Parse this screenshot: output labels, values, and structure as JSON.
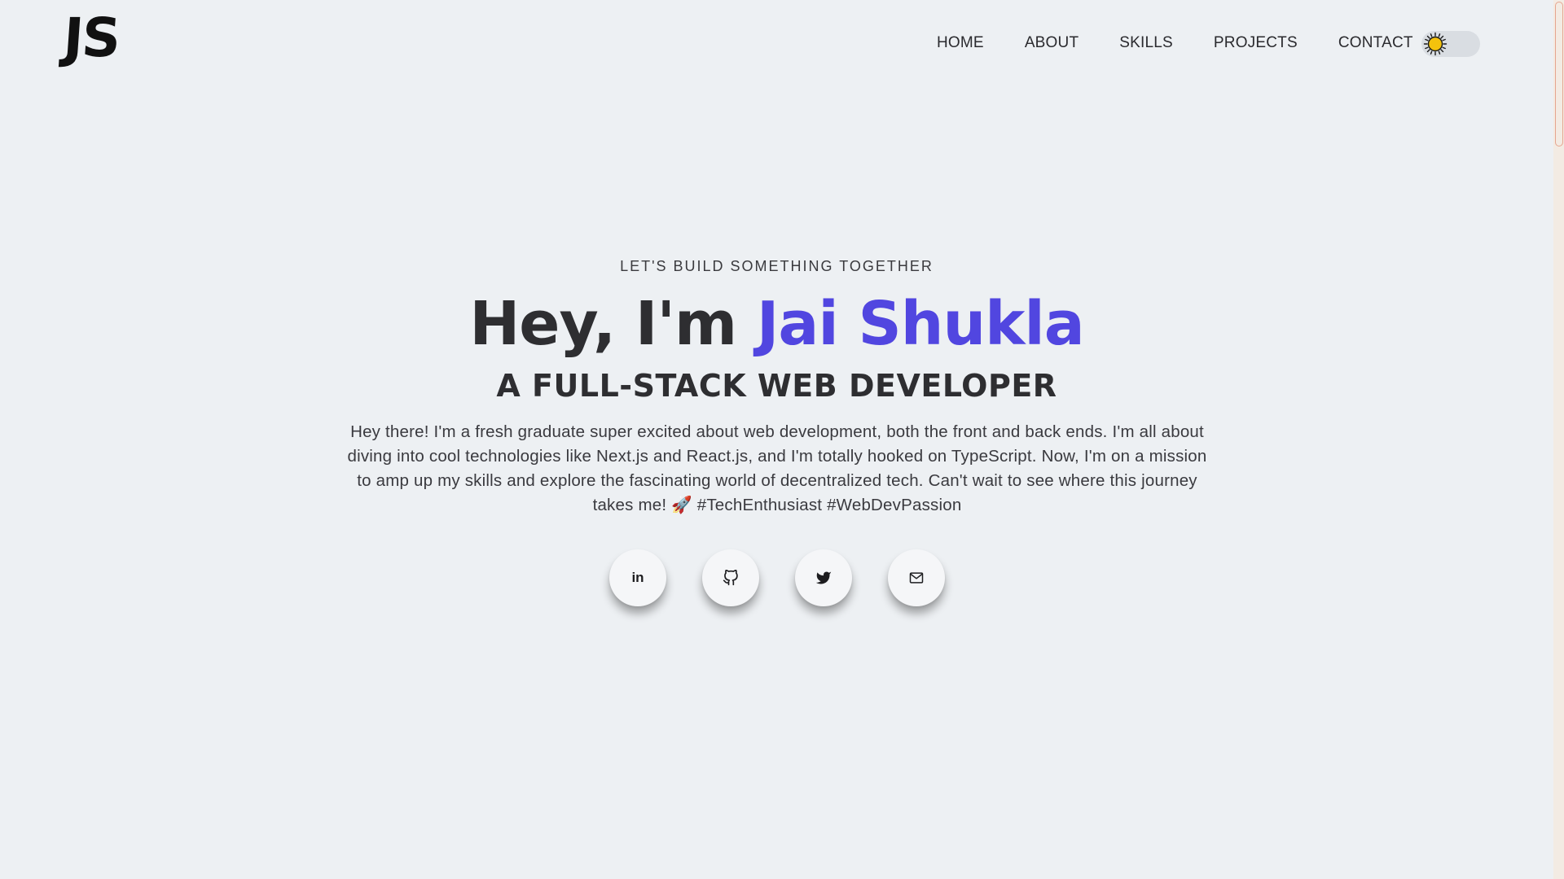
{
  "header": {
    "logo_text": "JS",
    "nav": [
      "HOME",
      "ABOUT",
      "SKILLS",
      "PROJECTS",
      "CONTACT"
    ],
    "theme_toggle": {
      "state": "light",
      "icon": "sun-icon"
    }
  },
  "hero": {
    "eyebrow": "LET'S BUILD SOMETHING TOGETHER",
    "greeting": "Hey, I'm ",
    "name": "Jai Shukla",
    "role": "A FULL-STACK WEB DEVELOPER",
    "intro": "Hey there! I'm a fresh graduate super excited about web development, both the front and back ends. I'm all about diving into cool technologies like Next.js and React.js, and I'm totally hooked on TypeScript. Now, I'm on a mission to amp up my skills and explore the fascinating world of decentralized tech. Can't wait to see where this journey takes me! 🚀 #TechEnthusiast #WebDevPassion"
  },
  "socials": [
    {
      "name": "linkedin",
      "icon": "linkedin-icon",
      "text": "in"
    },
    {
      "name": "github",
      "icon": "github-icon"
    },
    {
      "name": "twitter",
      "icon": "twitter-icon"
    },
    {
      "name": "email",
      "icon": "mail-icon"
    }
  ],
  "colors": {
    "background": "#edf0f3",
    "accent": "#5146e0",
    "text": "#2e2e31",
    "sun": "#f4c20d"
  }
}
